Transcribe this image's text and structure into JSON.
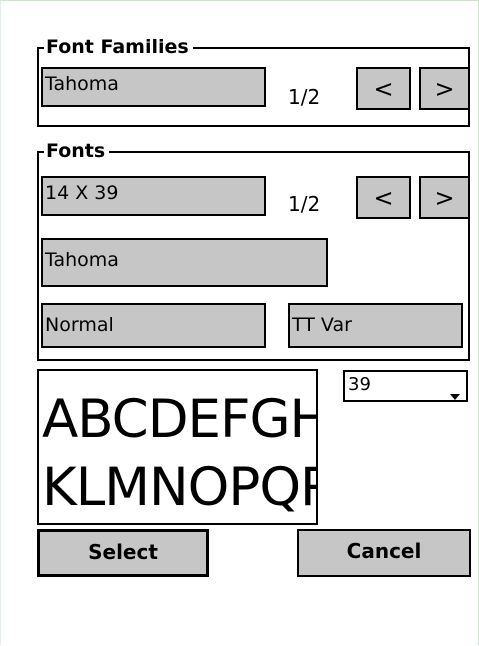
{
  "font_families": {
    "legend": "Font Families",
    "selected_family": "Tahoma",
    "page_counter": "1/2",
    "prev_label": "<",
    "next_label": ">"
  },
  "fonts": {
    "legend": "Fonts",
    "size_value": "14 X 39",
    "page_counter": "1/2",
    "prev_label": "<",
    "next_label": ">",
    "face_name": "Tahoma",
    "weight": "Normal",
    "type": "TT Var"
  },
  "preview": {
    "line1": "ABCDEFGHIJ",
    "line2": "KLMNOPQRST"
  },
  "size_dropdown": {
    "selected": "39"
  },
  "actions": {
    "select_label": "Select",
    "cancel_label": "Cancel"
  }
}
